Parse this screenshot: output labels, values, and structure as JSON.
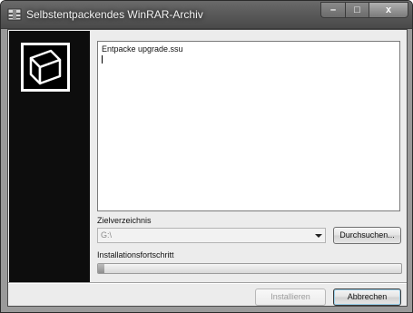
{
  "window": {
    "title": "Selbstentpackendes WinRAR-Archiv",
    "controls": {
      "minimize": "–",
      "maximize": "□",
      "close": "x"
    }
  },
  "log": {
    "text": "Entpacke upgrade.ssu"
  },
  "destination": {
    "label": "Zielverzeichnis",
    "value": "G:\\",
    "browse_label": "Durchsuchen..."
  },
  "progress": {
    "label": "Installationsfortschritt",
    "fraction": 0.02
  },
  "buttons": {
    "install_label": "Installieren",
    "cancel_label": "Abbrechen"
  }
}
